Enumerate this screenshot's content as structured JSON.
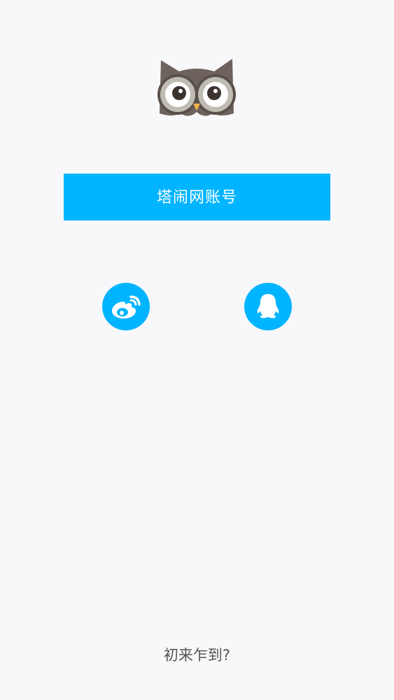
{
  "colors": {
    "accent": "#00b4ff",
    "background": "#f8f8fa",
    "owl_body": "#6d625d",
    "owl_eye_ring": "#bfbcb3",
    "text_secondary": "#555555"
  },
  "logo": {
    "icon": "owl-logo-icon"
  },
  "login": {
    "account_button_label": "塔闹网账号"
  },
  "social": {
    "weibo_icon": "weibo-icon",
    "qq_icon": "qq-icon"
  },
  "footer": {
    "newcomer_link": "初来乍到?"
  }
}
